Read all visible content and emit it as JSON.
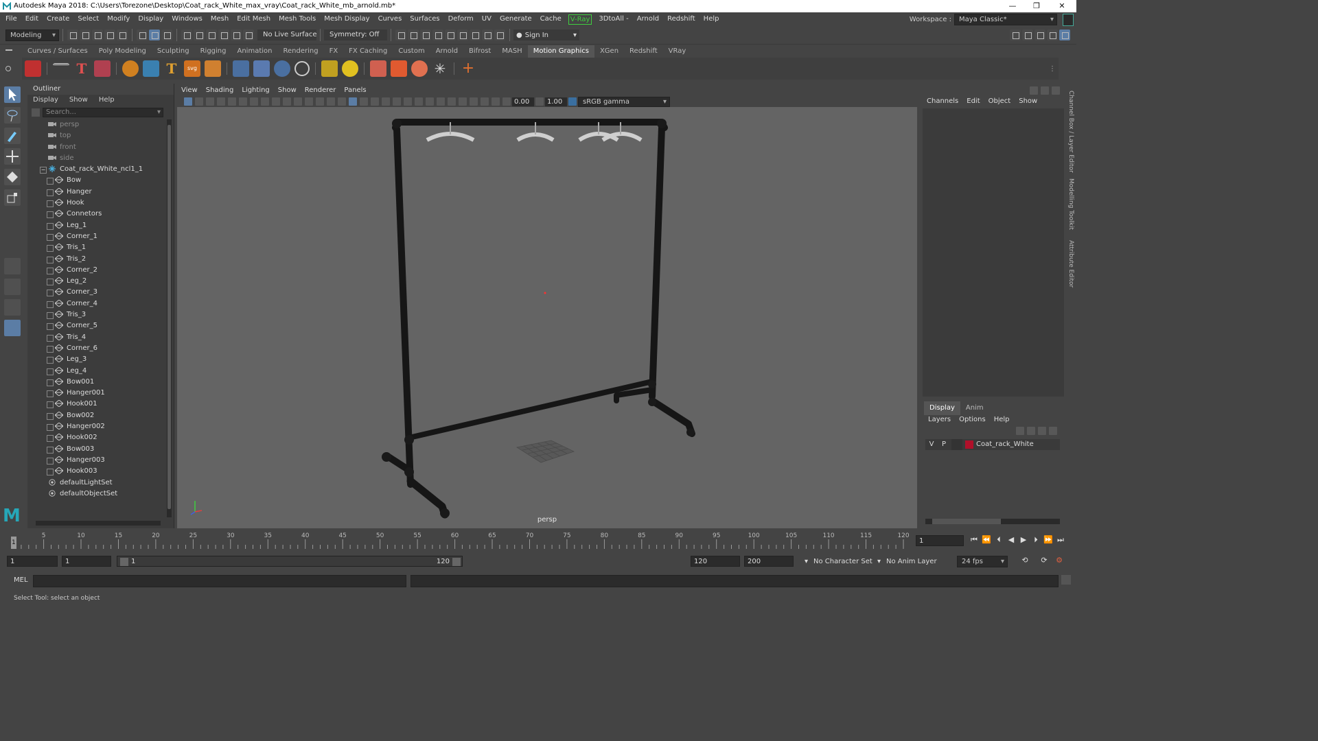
{
  "window": {
    "title": "Autodesk Maya 2018: C:\\Users\\Torezone\\Desktop\\Coat_rack_White_max_vray\\Coat_rack_White_mb_arnold.mb*",
    "controls": [
      "—",
      "❐",
      "✕"
    ]
  },
  "menubar": {
    "items": [
      "File",
      "Edit",
      "Create",
      "Select",
      "Modify",
      "Display",
      "Windows",
      "Mesh",
      "Edit Mesh",
      "Mesh Tools",
      "Mesh Display",
      "Curves",
      "Surfaces",
      "Deform",
      "UV",
      "Generate",
      "Cache"
    ],
    "vray": "V-Ray",
    "items2": [
      "3DtoAll -",
      "Arnold",
      "Redshift",
      "Help"
    ],
    "workspace_label": "Workspace :",
    "workspace_value": "Maya Classic*"
  },
  "statusline": {
    "mode": "Modeling",
    "live_surface": "No Live Surface",
    "symmetry": "Symmetry: Off",
    "sign_in": "Sign In"
  },
  "shelf": {
    "tabs": [
      "Curves / Surfaces",
      "Poly Modeling",
      "Sculpting",
      "Rigging",
      "Animation",
      "Rendering",
      "FX",
      "FX Caching",
      "Custom",
      "Arnold",
      "Bifrost",
      "MASH",
      "Motion Graphics",
      "XGen",
      "Redshift",
      "VRay"
    ],
    "active_tab": "Motion Graphics",
    "icon_text_t": "T",
    "icon_text_svg": "svg"
  },
  "outliner": {
    "title": "Outliner",
    "menu": [
      "Display",
      "Show",
      "Help"
    ],
    "search_placeholder": "Search...",
    "cameras": [
      "persp",
      "top",
      "front",
      "side"
    ],
    "group": "Coat_rack_White_ncl1_1",
    "children": [
      "Bow",
      "Hanger",
      "Hook",
      "Connetors",
      "Leg_1",
      "Corner_1",
      "Tris_1",
      "Tris_2",
      "Corner_2",
      "Leg_2",
      "Corner_3",
      "Corner_4",
      "Tris_3",
      "Corner_5",
      "Tris_4",
      "Corner_6",
      "Leg_3",
      "Leg_4",
      "Bow001",
      "Hanger001",
      "Hook001",
      "Bow002",
      "Hanger002",
      "Hook002",
      "Bow003",
      "Hanger003",
      "Hook003"
    ],
    "sets": [
      "defaultLightSet",
      "defaultObjectSet"
    ]
  },
  "viewport": {
    "menu": [
      "View",
      "Shading",
      "Lighting",
      "Show",
      "Renderer",
      "Panels"
    ],
    "exposure": "0.00",
    "gamma": "1.00",
    "color_space": "sRGB gamma",
    "camera_label": "persp"
  },
  "channelbox": {
    "menu": [
      "Channels",
      "Edit",
      "Object",
      "Show"
    ]
  },
  "layers": {
    "tabs": [
      "Display",
      "Anim"
    ],
    "active_tab": "Display",
    "menu": [
      "Layers",
      "Options",
      "Help"
    ],
    "layer": {
      "v": "V",
      "p": "P",
      "name": "Coat_rack_White",
      "color": "#b0102a"
    }
  },
  "sidetabs": [
    "Channel Box / Layer Editor",
    "Modelling Toolkit",
    "Attribute Editor"
  ],
  "timeslider": {
    "ticks": [
      "5",
      "10",
      "15",
      "20",
      "25",
      "30",
      "35",
      "40",
      "45",
      "50",
      "55",
      "60",
      "65",
      "70",
      "75",
      "80",
      "85",
      "90",
      "95",
      "100",
      "105",
      "110",
      "115",
      "120"
    ],
    "current_marker": "1",
    "current_frame": "1"
  },
  "range": {
    "start": "1",
    "anim_start": "1",
    "range_start": "1",
    "range_end": "120",
    "end": "120",
    "anim_end": "200",
    "character_set": "No Character Set",
    "anim_layer": "No Anim Layer",
    "fps": "24 fps"
  },
  "cmdline": {
    "label": "MEL"
  },
  "helpline": {
    "text": "Select Tool: select an object"
  }
}
